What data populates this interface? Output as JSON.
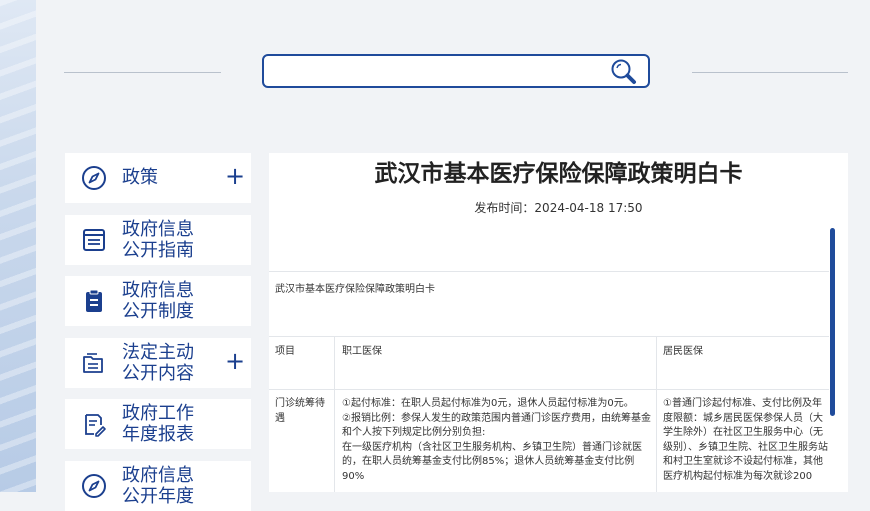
{
  "search": {
    "placeholder": "",
    "value": ""
  },
  "sidebar": {
    "items": [
      {
        "label": "政策",
        "has_plus": true,
        "icon": "compass-icon"
      },
      {
        "label": "政府信息\n公开指南",
        "has_plus": false,
        "icon": "document-list-icon"
      },
      {
        "label": "政府信息\n公开制度",
        "has_plus": false,
        "icon": "clipboard-icon"
      },
      {
        "label": "法定主动\n公开内容",
        "has_plus": true,
        "icon": "folder-stack-icon"
      },
      {
        "label": "政府工作\n年度报表",
        "has_plus": false,
        "icon": "report-edit-icon"
      },
      {
        "label": "政府信息\n公开年度",
        "has_plus": false,
        "icon": "compass-icon"
      }
    ],
    "plus_glyph": "+"
  },
  "article": {
    "title": "武汉市基本医疗保险保障政策明白卡",
    "publish_time": "发布时间：2024-04-18 17:50",
    "subtitle": "武汉市基本医疗保险保障政策明白卡",
    "table": {
      "headers": [
        "项目",
        "职工医保",
        "居民医保"
      ],
      "row1_label": "门诊统筹待遇",
      "row1_col1": "①起付标准：在职人员起付标准为0元，退休人员起付标准为0元。\n②报销比例：参保人发生的政策范围内普通门诊医疗费用，由统筹基金和个人按下列规定比例分别负担:\n在一级医疗机构（含社区卫生服务机构、乡镇卫生院）普通门诊就医的，在职人员统筹基金支付比例85%；退休人员统筹基金支付比例90%",
      "row1_col2": "①普通门诊起付标准、支付比例及年度限额：城乡居民医保参保人员（大学生除外）在社区卫生服务中心（无级别）、乡镇卫生院、社区卫生服务站和村卫生室就诊不设起付标准，其他医疗机构起付标准为每次就诊200"
    }
  },
  "colors": {
    "accent": "#1f4b9b",
    "background": "#f1f3f6"
  }
}
